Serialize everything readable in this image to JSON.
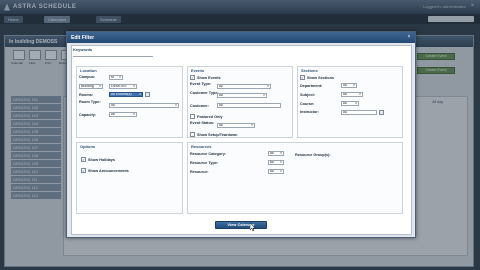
{
  "app": {
    "brand": "ASTRA SCHEDULE",
    "user_text": "Logged in: administrator",
    "window_close_glyph": "×",
    "nav_tabs": [
      "Home",
      "Calendars",
      "Schedule"
    ],
    "panel_title": "In building DEMOSS",
    "toolbar": [
      {
        "label": "Calendar",
        "icon": "calendar-icon"
      },
      {
        "label": "Filter",
        "icon": "filter-icon"
      },
      {
        "label": "Print",
        "icon": "print-icon"
      },
      {
        "label": "Refresh",
        "icon": "refresh-icon"
      }
    ],
    "room_rows": [
      "DEMOSS 101",
      "DEMOSS 102",
      "DEMOSS 103",
      "DEMOSS 104",
      "DEMOSS 105",
      "DEMOSS 106",
      "DEMOSS 107",
      "DEMOSS 108",
      "DEMOSS 109",
      "DEMOSS 110",
      "DEMOSS 111",
      "DEMOSS 112",
      "DEMOSS 113"
    ],
    "side_buttons": [
      "Create Event",
      "Create Event"
    ],
    "time_label": "All day"
  },
  "modal": {
    "title": "Edit Filter",
    "close_glyph": "×",
    "keywords_label": "Keywords",
    "keywords_value": "",
    "location": {
      "title": "Location",
      "campus_label": "Campus:",
      "campus_value": "M",
      "building_label": "Building",
      "building_value": "DEMOSS",
      "rooms_label": "Rooms:",
      "rooms_value": "All Rooms(s)",
      "room_type_label": "Room Type:",
      "room_type_value": "All",
      "capacity_label": "Capacity:",
      "capacity_value": "All"
    },
    "events": {
      "title": "Events",
      "show_events_label": "Show Events",
      "show_events_checked": true,
      "event_type_label": "Event Type:",
      "event_type_value": "All",
      "customer_type_label": "Customer Type:",
      "customer_type_value": "All",
      "customer_label": "Customer:",
      "customer_value": "All",
      "featured_only_label": "Featured Only",
      "featured_only_checked": false,
      "event_status_label": "Event Status:",
      "event_status_value": "All",
      "show_setup_label": "Show Setup/Teardown",
      "show_setup_checked": false
    },
    "sections": {
      "title": "Sections",
      "show_sections_label": "Show Sections",
      "show_sections_checked": true,
      "department_label": "Department:",
      "department_value": "All",
      "subject_label": "Subject:",
      "subject_value": "All",
      "course_label": "Course:",
      "course_value": "All",
      "instructor_label": "Instructor:",
      "instructor_value": "All"
    },
    "options": {
      "title": "Options",
      "show_holidays_label": "Show Holidays",
      "show_holidays_checked": true,
      "show_announcements_label": "Show Announcements",
      "show_announcements_checked": true
    },
    "resources": {
      "title": "Resources",
      "resource_category_label": "Resource Category:",
      "resource_category_value": "All",
      "resource_type_label": "Resource Type:",
      "resource_type_value": "All",
      "resource_label": "Resource:",
      "resource_value": "All",
      "resource_group_label": "Resource Group(s):"
    },
    "view_button_label": "View Calendar"
  },
  "colors": {
    "modal_header": "#2f5a86",
    "accent_blue": "#3f72b0",
    "green_button": "#5f8a52"
  }
}
